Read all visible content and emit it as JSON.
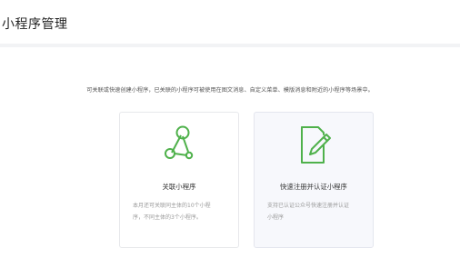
{
  "page": {
    "title": "小程序管理"
  },
  "intro": {
    "text": "可关联或快速创建小程序，已关联的小程序可被使用在图文消息、自定义菜单、模版消息和附近的小程序等场景中。"
  },
  "cards": [
    {
      "title": "关联小程序",
      "desc_lines": [
        "本月还可关联同主体的10个小程",
        "序，不同主体的3个小程序。"
      ],
      "icon": "link-nodes-icon"
    },
    {
      "title": "快速注册并认证小程序",
      "desc_lines": [
        "支持已认证公众号快速注册并认证",
        "小程序"
      ],
      "icon": "document-edit-icon"
    }
  ],
  "colors": {
    "accent": "#4fb14b",
    "background": "#f2f3f5",
    "card_hover": "#f7f8fc"
  }
}
